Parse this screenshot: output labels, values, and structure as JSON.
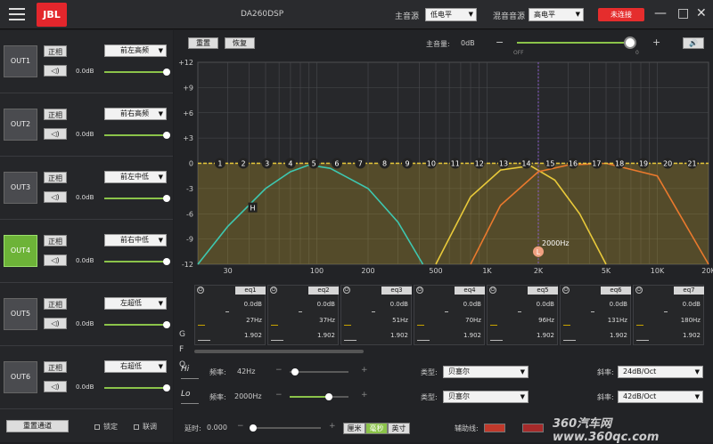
{
  "app": {
    "logo": "JBL",
    "device_title": "DA260DSP",
    "master_source_label": "主音源",
    "master_source_value": "低电平",
    "mix_source_label": "混音音源",
    "mix_source_value": "高电平",
    "connect_label": "未连接"
  },
  "outputs": [
    {
      "name": "OUT1",
      "phase": "正相",
      "channel": "前左高频",
      "gain": "0.0dB",
      "level": 1.0,
      "active": false
    },
    {
      "name": "OUT2",
      "phase": "正相",
      "channel": "前右高频",
      "gain": "0.0dB",
      "level": 1.0,
      "active": false
    },
    {
      "name": "OUT3",
      "phase": "正相",
      "channel": "前左中低",
      "gain": "0.0dB",
      "level": 1.0,
      "active": false
    },
    {
      "name": "OUT4",
      "phase": "正相",
      "channel": "前右中低",
      "gain": "0.0dB",
      "level": 1.0,
      "active": true
    },
    {
      "name": "OUT5",
      "phase": "正相",
      "channel": "左超低",
      "gain": "0.0dB",
      "level": 1.0,
      "active": false
    },
    {
      "name": "OUT6",
      "phase": "正相",
      "channel": "右超低",
      "gain": "0.0dB",
      "level": 1.0,
      "active": false
    }
  ],
  "left_bottom": {
    "reset_channel": "重置通道",
    "lock": "锁定",
    "link": "联调"
  },
  "toolbar": {
    "reset": "重置",
    "restore": "恢复",
    "master_volume_label": "主音量:",
    "master_volume_value": "0dB",
    "off_label": "OFF",
    "zero_label": "0",
    "minus": "−",
    "plus": "+",
    "master_level": 0.98
  },
  "chart": {
    "y_ticks": [
      "+12",
      "+9",
      "+6",
      "+3",
      "0",
      "-3",
      "-6",
      "-9",
      "-12"
    ],
    "x_ticks": [
      "30",
      "100",
      "200",
      "500",
      "1K",
      "2K",
      "5K",
      "10K",
      "20K"
    ],
    "eq_points": [
      "1",
      "2",
      "3",
      "4",
      "5",
      "6",
      "7",
      "8",
      "9",
      "10",
      "11",
      "12",
      "13",
      "14",
      "15",
      "16",
      "17",
      "18",
      "19",
      "20",
      "21"
    ],
    "marker_h": "H",
    "marker_l": "L",
    "crossover_label": "2000Hz"
  },
  "chart_data": {
    "type": "line",
    "x_scale": "log",
    "xlim": [
      20,
      20000
    ],
    "ylim": [
      -12,
      12
    ],
    "series": [
      {
        "name": "eq",
        "x": [
          20,
          20000
        ],
        "y": [
          0,
          0
        ]
      },
      {
        "name": "hp",
        "x": [
          20,
          30,
          50,
          70,
          90,
          120,
          200,
          300,
          420
        ],
        "y": [
          -12,
          -7.5,
          -3,
          -1,
          -0.2,
          -0.6,
          -3,
          -7,
          -12
        ]
      },
      {
        "name": "lp",
        "x": [
          500,
          800,
          1200,
          1800,
          2500,
          3500,
          5000
        ],
        "y": [
          -12,
          -4,
          -0.8,
          -0.3,
          -2,
          -6,
          -12
        ]
      },
      {
        "name": "sub",
        "x": [
          800,
          1200,
          2000,
          3000,
          5000,
          10000,
          20000
        ],
        "y": [
          -12,
          -5,
          -1,
          -0.2,
          0,
          -1.5,
          -12
        ]
      }
    ]
  },
  "eq_bands": [
    {
      "name": "eq1",
      "gain": "0.0dB",
      "freq": "27Hz",
      "q": "1.902"
    },
    {
      "name": "eq2",
      "gain": "0.0dB",
      "freq": "37Hz",
      "q": "1.902"
    },
    {
      "name": "eq3",
      "gain": "0.0dB",
      "freq": "51Hz",
      "q": "1.902"
    },
    {
      "name": "eq4",
      "gain": "0.0dB",
      "freq": "70Hz",
      "q": "1.902"
    },
    {
      "name": "eq5",
      "gain": "0.0dB",
      "freq": "96Hz",
      "q": "1.902"
    },
    {
      "name": "eq6",
      "gain": "0.0dB",
      "freq": "131Hz",
      "q": "1.902"
    },
    {
      "name": "eq7",
      "gain": "0.0dB",
      "freq": "180Hz",
      "q": "1.902"
    }
  ],
  "gfq": {
    "g": "G",
    "f": "F",
    "q": "Q"
  },
  "hi": {
    "tab": "Hi",
    "freq_label": "频率:",
    "freq": "42Hz",
    "type_label": "类型:",
    "type": "贝塞尔",
    "slope_label": "斜率:",
    "slope": "24dB/Oct"
  },
  "lo": {
    "tab": "Lo",
    "freq_label": "频率:",
    "freq": "2000Hz",
    "type_label": "类型:",
    "type": "贝塞尔",
    "slope_label": "斜率:",
    "slope": "42dB/Oct"
  },
  "bottom": {
    "delay_label": "延时:",
    "delay": "0.000",
    "units": [
      "厘米",
      "毫秒",
      "英寸"
    ],
    "selected_unit": 1,
    "aux_label": "辅助线:",
    "watermark": "360汽车网 www.360qc.com"
  }
}
